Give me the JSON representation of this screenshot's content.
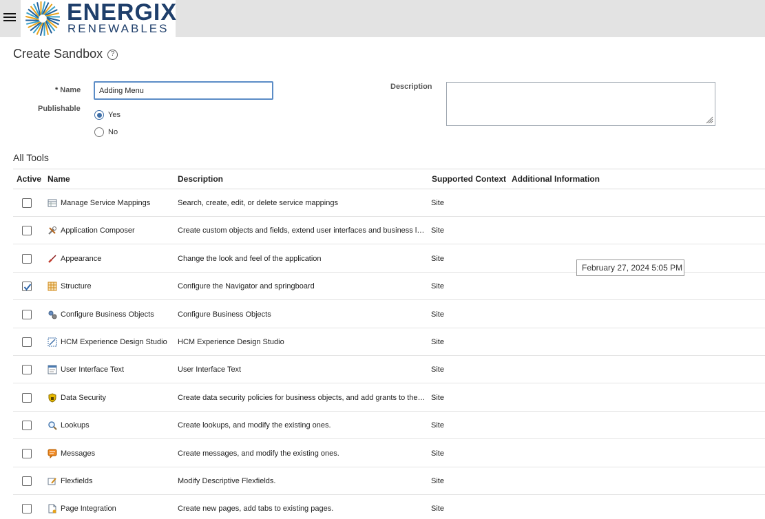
{
  "header": {
    "logo_line1": "ENERGIX",
    "logo_line2": "RENEWABLES",
    "menu_icon": "hamburger-icon"
  },
  "page": {
    "title": "Create Sandbox",
    "help_icon_glyph": "?"
  },
  "form": {
    "required_marker": "*",
    "name_label": "Name",
    "name_value": "Adding Menu",
    "publishable_label": "Publishable",
    "publishable_options": [
      "Yes",
      "No"
    ],
    "publishable_selected": "Yes",
    "description_label": "Description",
    "description_value": ""
  },
  "tools": {
    "section_title": "All Tools",
    "columns": [
      "Active",
      "Name",
      "Description",
      "Supported Context",
      "Additional Information"
    ],
    "rows": [
      {
        "active": false,
        "icon": "table-icon",
        "name": "Manage Service Mappings",
        "description": "Search, create, edit, or delete service mappings",
        "context": "Site"
      },
      {
        "active": false,
        "icon": "tools-icon",
        "name": "Application Composer",
        "description": "Create custom objects and fields, extend user interfaces and business logic",
        "context": "Site"
      },
      {
        "active": false,
        "icon": "brush-icon",
        "name": "Appearance",
        "description": "Change the look and feel of the application",
        "context": "Site"
      },
      {
        "active": true,
        "icon": "grid-icon",
        "name": "Structure",
        "description": "Configure the Navigator and springboard",
        "context": "Site"
      },
      {
        "active": false,
        "icon": "gears-icon",
        "name": "Configure Business Objects",
        "description": "Configure Business Objects",
        "context": "Site"
      },
      {
        "active": false,
        "icon": "design-icon",
        "name": "HCM Experience Design Studio",
        "description": "HCM Experience Design Studio",
        "context": "Site"
      },
      {
        "active": false,
        "icon": "text-window-icon",
        "name": "User Interface Text",
        "description": "User Interface Text",
        "context": "Site"
      },
      {
        "active": false,
        "icon": "shield-lock-icon",
        "name": "Data Security",
        "description": "Create data security policies for business objects, and add grants to the policies",
        "context": "Site"
      },
      {
        "active": false,
        "icon": "magnifier-icon",
        "name": "Lookups",
        "description": "Create lookups, and modify the existing ones.",
        "context": "Site"
      },
      {
        "active": false,
        "icon": "message-icon",
        "name": "Messages",
        "description": "Create messages, and modify the existing ones.",
        "context": "Site"
      },
      {
        "active": false,
        "icon": "flexfield-icon",
        "name": "Flexfields",
        "description": "Modify Descriptive Flexfields.",
        "context": "Site"
      },
      {
        "active": false,
        "icon": "page-add-icon",
        "name": "Page Integration",
        "description": "Create new pages, add tabs to existing pages.",
        "context": "Site"
      }
    ]
  },
  "tooltip": {
    "text": "February 27, 2024 5:05 PM"
  }
}
